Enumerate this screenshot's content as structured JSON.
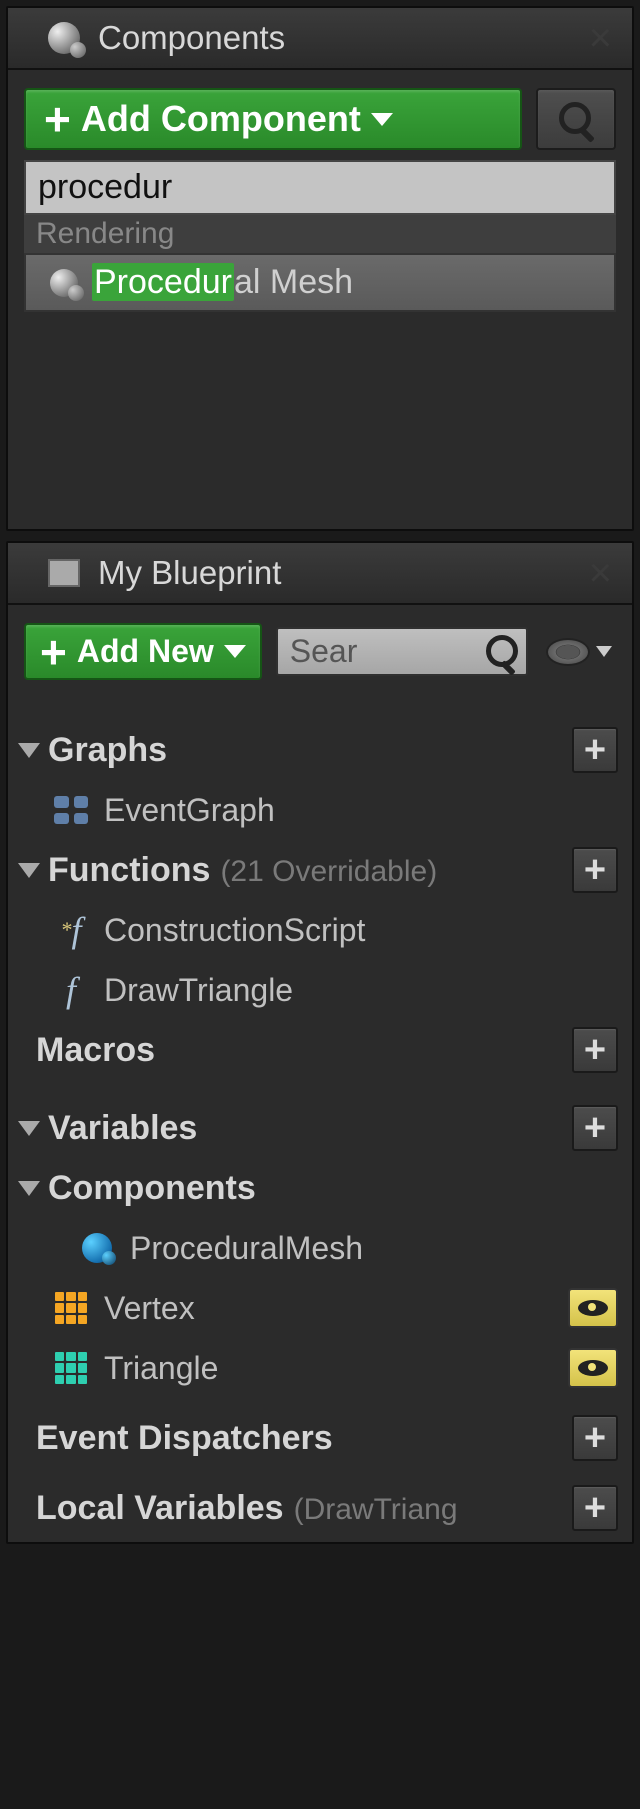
{
  "components_panel": {
    "title": "Components",
    "add_button": "Add Component",
    "search_input": "procedur",
    "dropdown": {
      "category": "Rendering",
      "match_prefix": "Procedur",
      "match_suffix": "al Mesh"
    }
  },
  "blueprint_panel": {
    "title": "My Blueprint",
    "add_button": "Add New",
    "search_placeholder": "Sear",
    "sections": {
      "graphs": {
        "label": "Graphs",
        "items": [
          "EventGraph"
        ]
      },
      "functions": {
        "label": "Functions",
        "annotation": "(21 Overridable)",
        "items": [
          "ConstructionScript",
          "DrawTriangle"
        ]
      },
      "macros": {
        "label": "Macros"
      },
      "variables": {
        "label": "Variables"
      },
      "components_sub": {
        "label": "Components",
        "items": [
          "ProceduralMesh",
          "Vertex",
          "Triangle"
        ]
      },
      "event_dispatchers": {
        "label": "Event Dispatchers"
      },
      "local_variables": {
        "label": "Local Variables",
        "annotation": "(DrawTriang"
      }
    }
  }
}
